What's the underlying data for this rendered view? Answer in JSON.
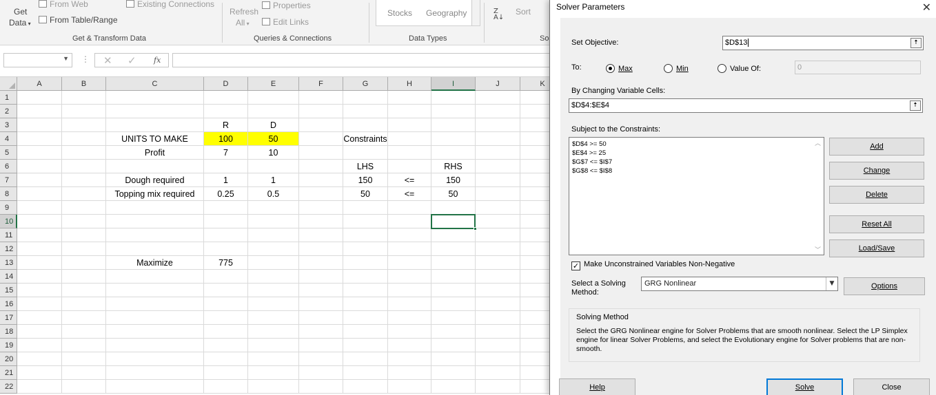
{
  "ribbon": {
    "get_data_label": "Get",
    "get_data_label2": "Data",
    "from_web": "From Web",
    "from_table_range": "From Table/Range",
    "existing_connections": "Existing Connections",
    "refresh_all_label": "Refresh",
    "refresh_all_label2": "All",
    "properties": "Properties",
    "edit_links": "Edit Links",
    "stocks": "Stocks",
    "geography": "Geography",
    "sort": "Sort",
    "group_get_transform": "Get & Transform Data",
    "group_queries": "Queries & Connections",
    "group_data_types": "Data Types",
    "group_sort_partial": "So"
  },
  "formula_bar": {
    "name_box": "",
    "cancel_icon": "✕",
    "enter_icon": "✓",
    "fx_label": "fx",
    "formula": ""
  },
  "grid": {
    "columns": [
      "A",
      "B",
      "C",
      "D",
      "E",
      "F",
      "G",
      "H",
      "I",
      "J",
      "K"
    ],
    "rows": [
      "1",
      "2",
      "3",
      "4",
      "5",
      "6",
      "7",
      "8",
      "9",
      "10",
      "11",
      "12",
      "13",
      "14",
      "15",
      "16",
      "17",
      "18",
      "19",
      "20",
      "21",
      "22"
    ],
    "selected_col": "I",
    "selected_row": "10",
    "cells": {
      "D3": "R",
      "E3": "D",
      "C4": "UNITS TO MAKE",
      "D4": "100",
      "E4": "50",
      "G4": "Constraints",
      "C5": "Profit",
      "D5": "7",
      "E5": "10",
      "G6": "LHS",
      "I6": "RHS",
      "C7": "Dough required",
      "D7": "1",
      "E7": "1",
      "G7": "150",
      "H7": "<=",
      "I7": "150",
      "C8": "Topping mix required",
      "D8": "0.25",
      "E8": "0.5",
      "G8": "50",
      "H8": "<=",
      "I8": "50",
      "C13": "Maximize",
      "D13": "775"
    },
    "highlight_color": "#ffff00",
    "selection_color": "#217346"
  },
  "solver": {
    "title": "Solver Parameters",
    "close_icon": "✕",
    "set_objective_label": "Set Objective:",
    "objective_value": "$D$13",
    "to_label": "To:",
    "radio_max": "Max",
    "radio_min": "Min",
    "radio_value_of": "Value Of:",
    "value_of_input": "0",
    "changing_cells_label": "By Changing Variable Cells:",
    "changing_cells_value": "$D$4:$E$4",
    "constraints_label": "Subject to the Constraints:",
    "constraints": [
      "$D$4 >= 50",
      "$E$4 >= 25",
      "$G$7 <= $I$7",
      "$G$8 <= $I$8"
    ],
    "btn_add": "Add",
    "btn_change": "Change",
    "btn_delete": "Delete",
    "btn_reset_all": "Reset All",
    "btn_load_save": "Load/Save",
    "non_negative_label": "Make Unconstrained Variables Non-Negative",
    "non_negative_checked": true,
    "select_method_label": "Select a Solving",
    "select_method_label2": "Method:",
    "method_value": "GRG Nonlinear",
    "btn_options": "Options",
    "solving_method_title": "Solving Method",
    "solving_method_text": "Select the GRG Nonlinear engine for Solver Problems that are smooth nonlinear. Select the LP Simplex engine for linear Solver Problems, and select the Evolutionary engine for Solver problems that are non-smooth.",
    "btn_help": "Help",
    "btn_solve": "Solve",
    "btn_close": "Close",
    "accent_color": "#0078d7"
  }
}
